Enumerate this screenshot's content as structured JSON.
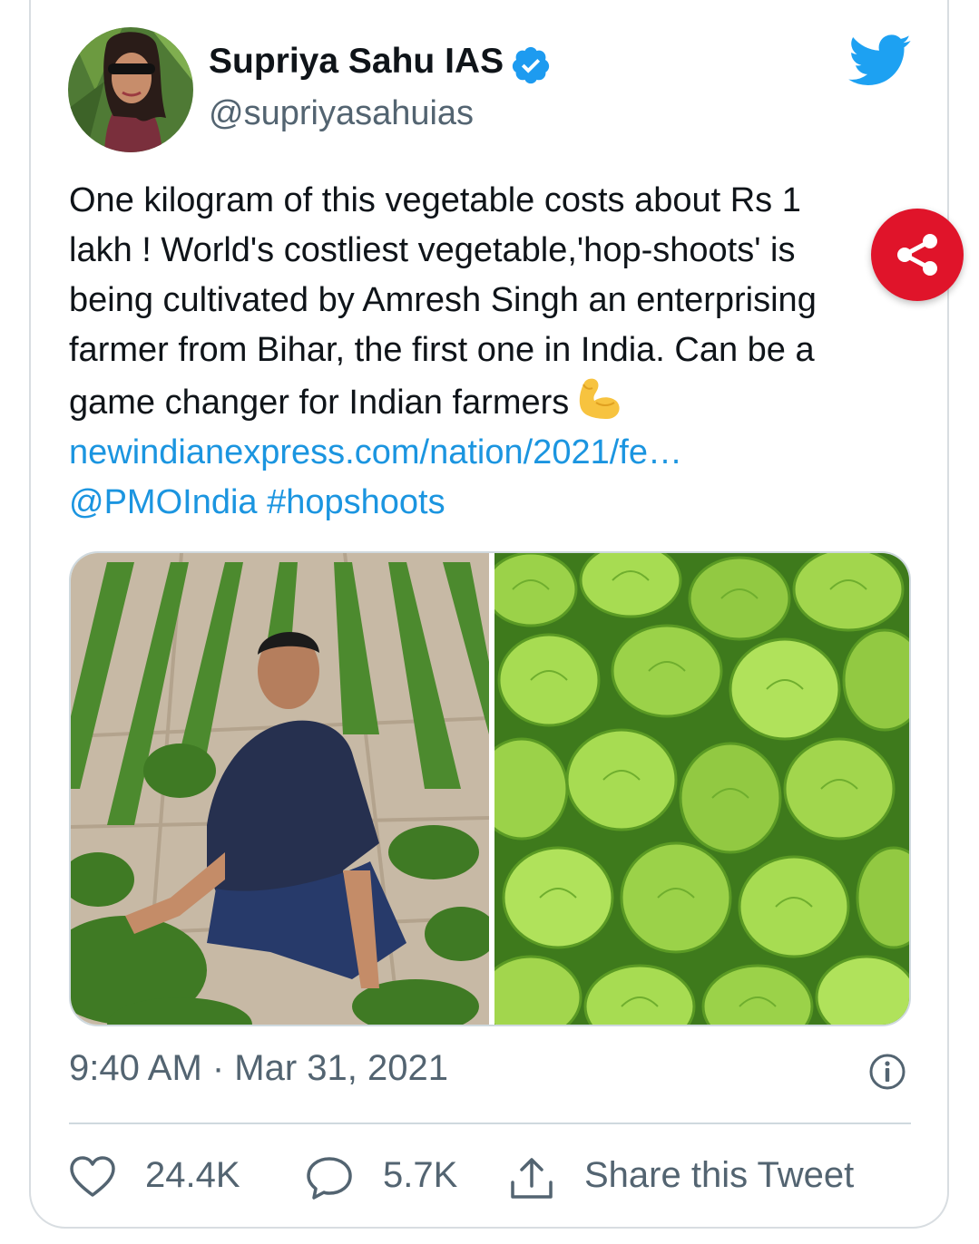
{
  "tweet": {
    "author_name": "Supriya Sahu IAS",
    "handle": "@supriyasahuias",
    "text_lines": [
      "One kilogram of this vegetable costs about Rs 1",
      "lakh ! World's costliest vegetable,'hop-shoots' is",
      "being cultivated by Amresh Singh an enterprising",
      "farmer from Bihar, the first one in India. Can be a",
      "game changer for Indian farmers"
    ],
    "emoji_icon": "flexed-biceps-icon",
    "link_text": "newindianexpress.com/nation/2021/fe…",
    "mention": "@PMOIndia",
    "hashtag": "#hopshoots",
    "timestamp": "9:40 AM · Mar 31, 2021"
  },
  "actions": {
    "likes": "24.4K",
    "replies": "5.7K",
    "share_label": "Share this Tweet"
  },
  "icons": {
    "verified": "verified-badge-icon",
    "brand": "twitter-bird-icon",
    "share_fab": "share-icon",
    "info": "info-icon",
    "like": "heart-icon",
    "reply": "speech-bubble-icon",
    "share": "upload-icon"
  },
  "colors": {
    "link": "#1b95e0",
    "verified": "#1d9bf0",
    "brand": "#1da1f2",
    "share_fab": "#e0142a",
    "secondary_text": "#536471"
  }
}
